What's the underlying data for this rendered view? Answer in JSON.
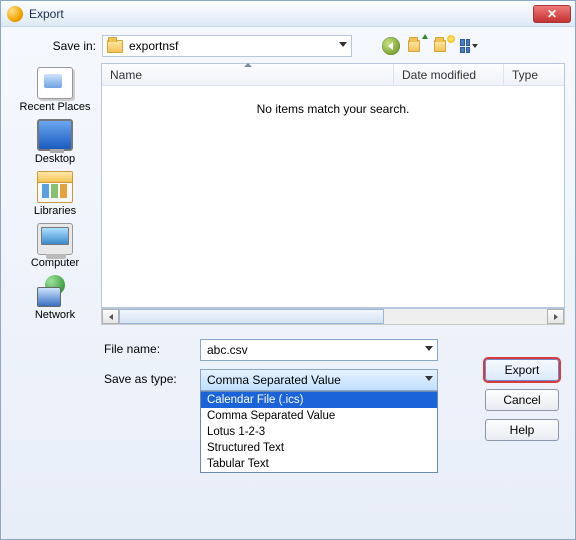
{
  "window": {
    "title": "Export"
  },
  "labels": {
    "savein": "Save in:",
    "filename": "File name:",
    "saveastype": "Save as type:"
  },
  "savein": {
    "folder": "exportnsf"
  },
  "places": {
    "recent": "Recent Places",
    "desktop": "Desktop",
    "libraries": "Libraries",
    "computer": "Computer",
    "network": "Network"
  },
  "list": {
    "col_name": "Name",
    "col_date": "Date modified",
    "col_type": "Type",
    "empty": "No items match your search."
  },
  "filename": {
    "value": "abc.csv"
  },
  "saveastype": {
    "selected": "Comma Separated Value",
    "options": {
      "o0": "Calendar File (.ics)",
      "o1": "Comma Separated Value",
      "o2": "Lotus 1-2-3",
      "o3": "Structured Text",
      "o4": "Tabular Text"
    }
  },
  "buttons": {
    "export": "Export",
    "cancel": "Cancel",
    "help": "Help"
  }
}
